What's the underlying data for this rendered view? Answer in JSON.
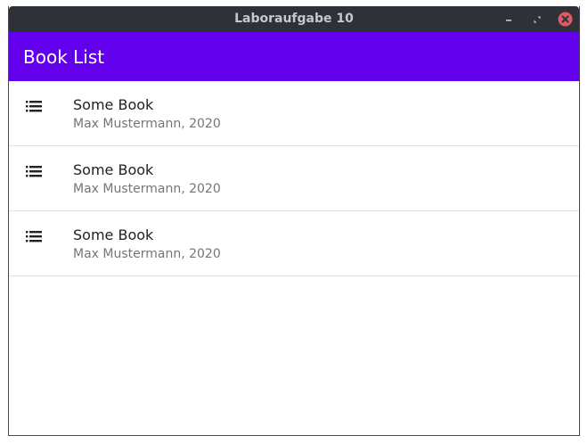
{
  "window": {
    "title": "Laboraufgabe 10",
    "controls": {
      "minimize_icon": "minimize-icon",
      "maximize_icon": "maximize-icon",
      "close_icon": "close-icon",
      "close_color": "#e05a62"
    }
  },
  "appbar": {
    "title": "Book List",
    "color": "#6200ee"
  },
  "books": [
    {
      "icon": "list-icon",
      "title": "Some Book",
      "subtitle": "Max Mustermann, 2020"
    },
    {
      "icon": "list-icon",
      "title": "Some Book",
      "subtitle": "Max Mustermann, 2020"
    },
    {
      "icon": "list-icon",
      "title": "Some Book",
      "subtitle": "Max Mustermann, 2020"
    }
  ]
}
